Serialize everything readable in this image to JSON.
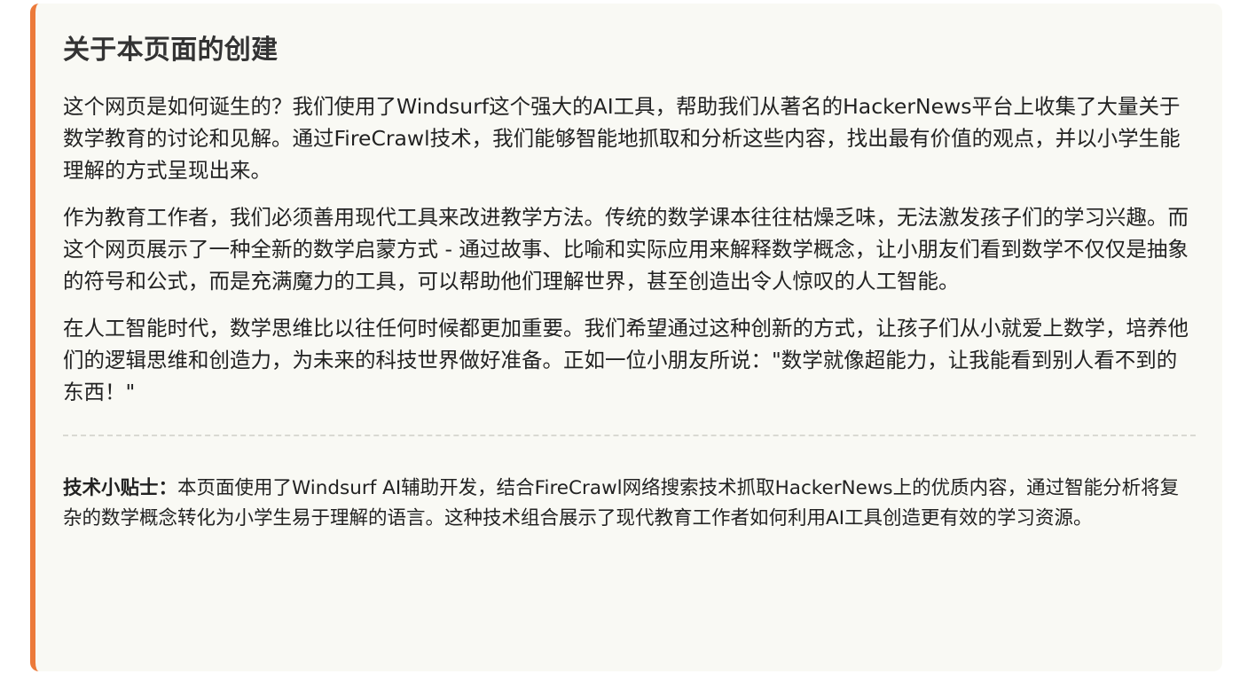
{
  "section": {
    "title": "关于本页面的创建",
    "paragraphs": [
      "这个网页是如何诞生的？我们使用了Windsurf这个强大的AI工具，帮助我们从著名的HackerNews平台上收集了大量关于数学教育的讨论和见解。通过FireCrawl技术，我们能够智能地抓取和分析这些内容，找出最有价值的观点，并以小学生能理解的方式呈现出来。",
      "作为教育工作者，我们必须善用现代工具来改进教学方法。传统的数学课本往往枯燥乏味，无法激发孩子们的学习兴趣。而这个网页展示了一种全新的数学启蒙方式 - 通过故事、比喻和实际应用来解释数学概念，让小朋友们看到数学不仅仅是抽象的符号和公式，而是充满魔力的工具，可以帮助他们理解世界，甚至创造出令人惊叹的人工智能。",
      "在人工智能时代，数学思维比以往任何时候都更加重要。我们希望通过这种创新的方式，让孩子们从小就爱上数学，培养他们的逻辑思维和创造力，为未来的科技世界做好准备。正如一位小朋友所说：\"数学就像超能力，让我能看到别人看不到的东西！\""
    ],
    "tip": {
      "label": "技术小贴士：",
      "text": "本页面使用了Windsurf AI辅助开发，结合FireCrawl网络搜索技术抓取HackerNews上的优质内容，通过智能分析将复杂的数学概念转化为小学生易于理解的语言。这种技术组合展示了现代教育工作者如何利用AI工具创造更有效的学习资源。"
    }
  },
  "colors": {
    "accent_border": "#ec7a3a",
    "card_background": "#f9f9f4",
    "divider": "#d9d9d2"
  }
}
